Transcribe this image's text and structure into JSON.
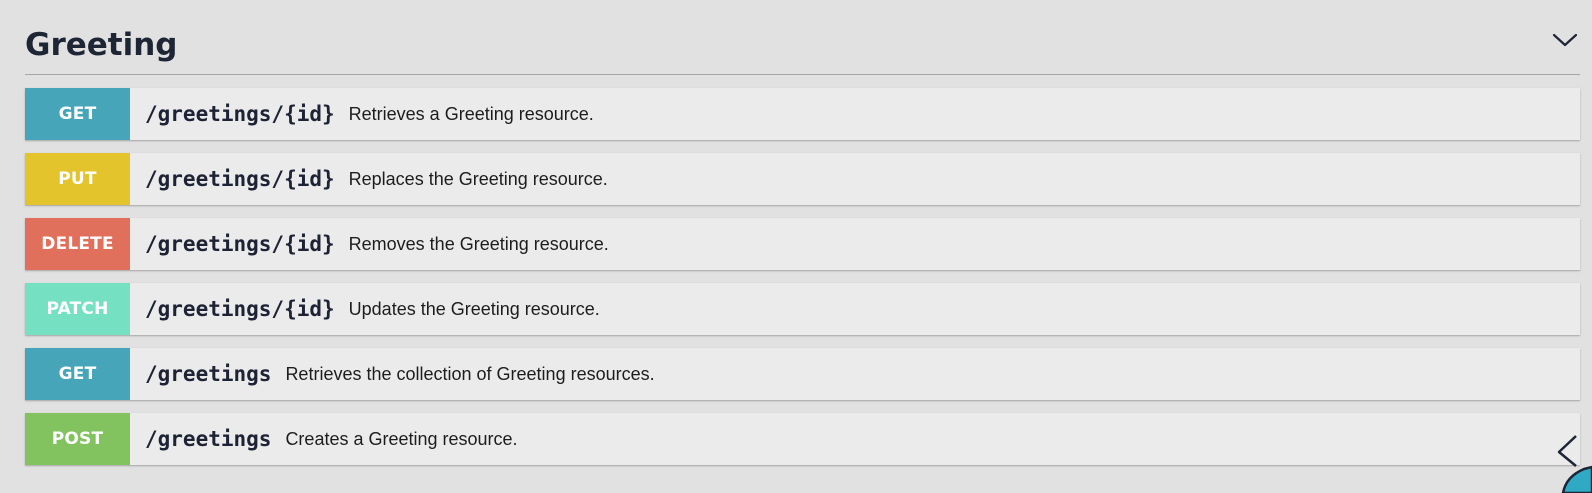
{
  "section": {
    "title": "Greeting",
    "toggle_icon": "chevron-down-icon"
  },
  "operations": [
    {
      "method": "GET",
      "path": "/greetings/{id}",
      "description": "Retrieves a Greeting resource.",
      "color": "#46a5b8"
    },
    {
      "method": "PUT",
      "path": "/greetings/{id}",
      "description": "Replaces the Greeting resource.",
      "color": "#e3c42c"
    },
    {
      "method": "DELETE",
      "path": "/greetings/{id}",
      "description": "Removes the Greeting resource.",
      "color": "#e06f5c"
    },
    {
      "method": "PATCH",
      "path": "/greetings/{id}",
      "description": "Updates the Greeting resource.",
      "color": "#76e1c2"
    },
    {
      "method": "GET",
      "path": "/greetings",
      "description": "Retrieves the collection of Greeting resources.",
      "color": "#46a5b8"
    },
    {
      "method": "POST",
      "path": "/greetings",
      "description": "Creates a Greeting resource.",
      "color": "#82c25f"
    }
  ],
  "colors": {
    "background": "#e1e1e1",
    "row_background": "#ebebeb",
    "title": "#1e2535"
  }
}
